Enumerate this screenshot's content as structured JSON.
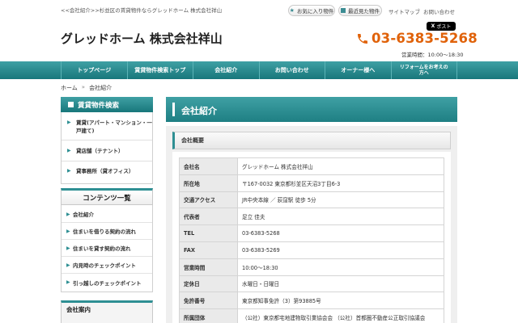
{
  "top_bar": {
    "tagline": "<<会社紹介>>杉並区の賃貸物件ならグレッドホーム 株式会社祥山",
    "favorites": "お気に入り物件",
    "recent": "最近見た物件",
    "sitemap": "サイトマップ",
    "separator": "|",
    "contact": "お問い合わせ"
  },
  "header": {
    "title": "グレッドホーム 株式会社祥山",
    "post_button": "ポスト",
    "x_glyph": "X",
    "phone": "03-6383-5268",
    "hours": "営業時間：10:00～18:30"
  },
  "nav": {
    "items": [
      "トップページ",
      "賃貸物件検索トップ",
      "会社紹介",
      "お問い合わせ",
      "オーナー様へ"
    ],
    "last_line1": "リフォームをお考えの",
    "last_line2": "方へ"
  },
  "breadcrumb": {
    "home": "ホーム",
    "sep": "»",
    "current": "会社紹介"
  },
  "sidebar": {
    "rental_title": "賃貸物件検索",
    "rental_items": [
      "賃貸(アパート・マンション・一戸建て)",
      "貸店舗（テナント）",
      "貸事務所（貸オフィス）"
    ],
    "arrow": "▶",
    "contents_title": "コンテンツ一覧",
    "contents_items": [
      "会社紹介",
      "住まいを借りる契約の流れ",
      "住まいを貸す契約の流れ",
      "内見時のチェックポイント",
      "引っ越しのチェックポイント"
    ],
    "info_title": "会社案内"
  },
  "main": {
    "title": "会社紹介",
    "section_title": "会社概要",
    "rows": [
      {
        "k": "会社名",
        "v": "グレッドホーム 株式会社祥山"
      },
      {
        "k": "所在地",
        "v": "〒167-0032 東京都杉並区天沼3丁目6-3"
      },
      {
        "k": "交通アクセス",
        "v": "JR中央本線 ／ 荻窪駅 徒歩 5分"
      },
      {
        "k": "代表者",
        "v": "足立 佳夫"
      },
      {
        "k": "TEL",
        "v": "03-6383-5268"
      },
      {
        "k": "FAX",
        "v": "03-6383-5269"
      },
      {
        "k": "営業時間",
        "v": "10:00～18:30"
      },
      {
        "k": "定休日",
        "v": "水曜日・日曜日"
      },
      {
        "k": "免許番号",
        "v": "東京都知事免許（3）第93885号"
      },
      {
        "k": "所属団体",
        "v": "（公社）東京都宅地建物取引業協会会 （公社）首都圏不動産公正取引協議会"
      }
    ]
  },
  "colors": {
    "teal": "#2e8f93",
    "phone_orange": "#e0620a"
  },
  "icons": [
    "star-icon",
    "history-icon",
    "x-logo-icon",
    "phone-icon",
    "arrow-right-icon"
  ]
}
